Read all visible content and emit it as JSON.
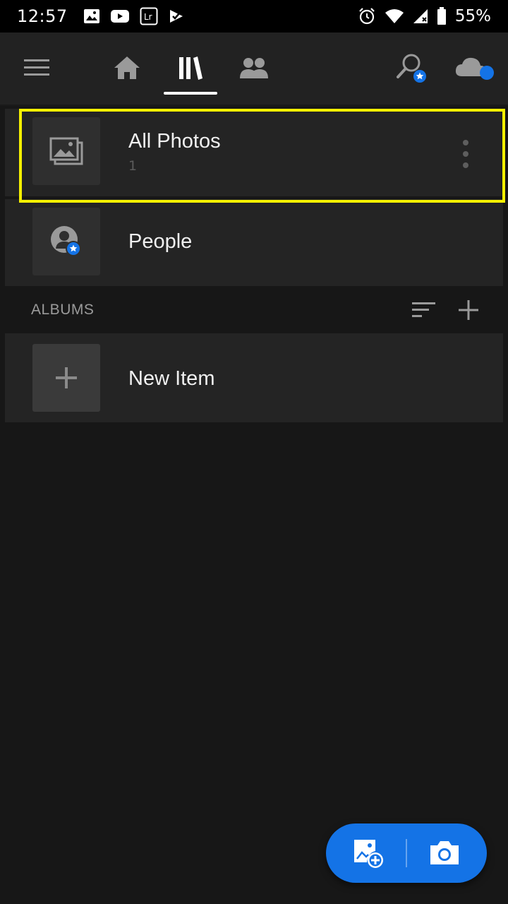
{
  "status_bar": {
    "time": "12:57",
    "battery": "55%"
  },
  "toolbar": {
    "active_tab": "library"
  },
  "library": {
    "all_photos": {
      "title": "All Photos",
      "count": "1"
    },
    "people": {
      "title": "People"
    }
  },
  "albums": {
    "header": "ALBUMS",
    "new_item": {
      "title": "New Item"
    }
  },
  "colors": {
    "accent": "#1473e6",
    "highlight": "#f5f000",
    "background": "#171717",
    "row": "#242424",
    "toolbar": "#222222"
  }
}
